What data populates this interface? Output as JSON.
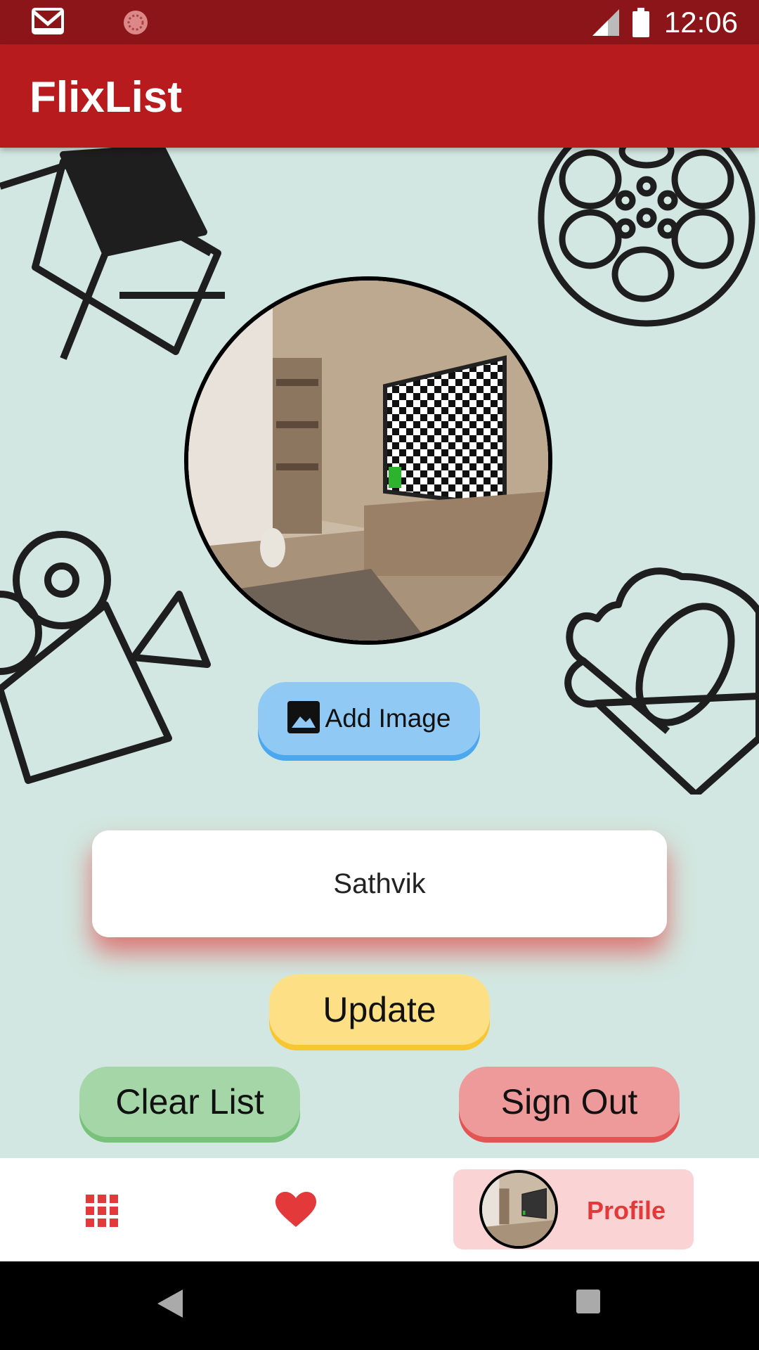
{
  "status_bar": {
    "time": "12:06",
    "icons": [
      "gmail-icon",
      "sync-icon",
      "signal-icon",
      "battery-icon"
    ]
  },
  "app_bar": {
    "title": "FlixList"
  },
  "profile": {
    "avatar_alt": "profile-image",
    "add_image_label": "Add Image",
    "name": "Sathvik",
    "update_label": "Update",
    "clear_list_label": "Clear List",
    "sign_out_label": "Sign Out"
  },
  "bottom_nav": {
    "items": [
      {
        "icon": "grid-icon"
      },
      {
        "icon": "heart-icon"
      },
      {
        "icon": "avatar",
        "label": "Profile",
        "selected": true
      }
    ]
  },
  "colors": {
    "status_bar": "#8b1519",
    "app_bar": "#b81b1e",
    "background": "#d2e7e1",
    "add_image": "#91c9f5",
    "update": "#fde085",
    "clear_list": "#a5d6a7",
    "sign_out": "#ef9a9a",
    "profile_tab": "#fad4d4",
    "accent_red": "#e3393b"
  }
}
